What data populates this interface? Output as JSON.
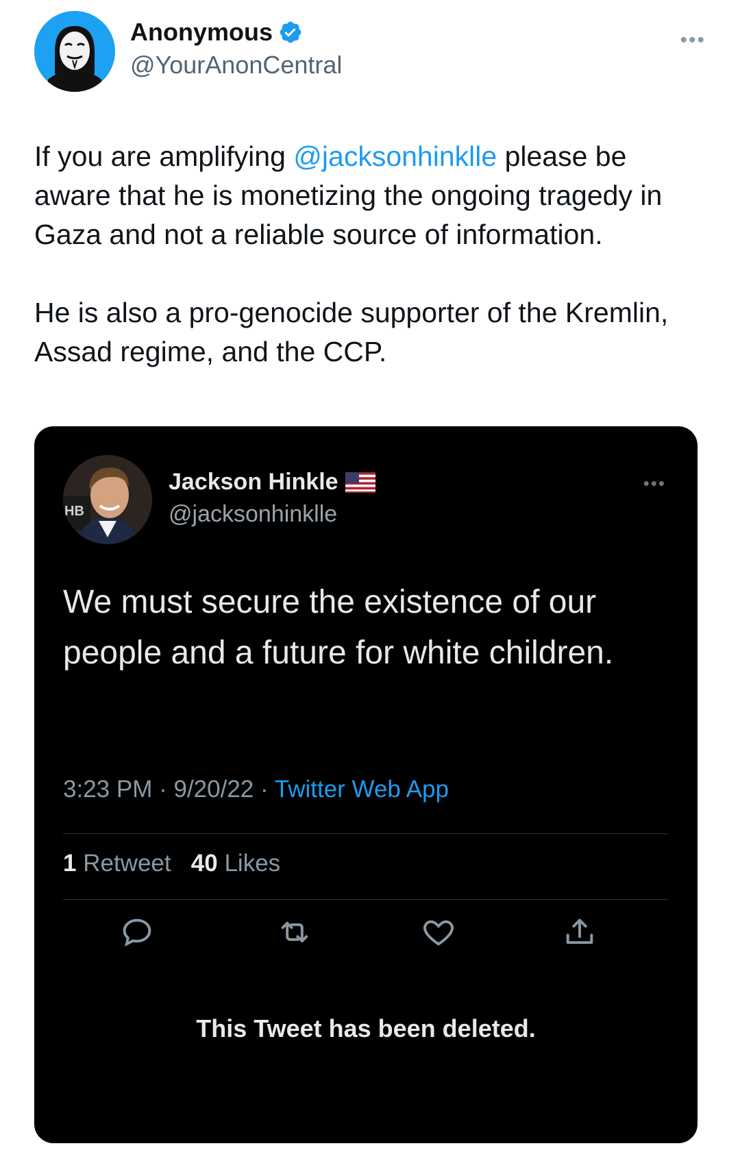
{
  "tweet": {
    "author": {
      "display_name": "Anonymous",
      "handle": "@YourAnonCentral",
      "verified": true,
      "avatar_icon": "anonymous-mask-icon"
    },
    "text": {
      "p1_before": "If you are amplifying ",
      "p1_mention": "@jacksonhinklle",
      "p1_after": " please be aware that he is monetizing the ongoing tragedy in Gaza and not a reliable source of information.",
      "p2": "He is also a pro-genocide supporter of the Kremlin, Assad regime, and the CCP."
    }
  },
  "embedded_tweet": {
    "author": {
      "display_name": "Jackson Hinkle",
      "handle": "@jacksonhinklle",
      "flag_icon": "us-flag-icon"
    },
    "text": "We must secure the existence of our people and a future for white children.",
    "time": "3:23 PM",
    "date": "9/20/22",
    "source": "Twitter Web App",
    "separator": "·",
    "retweets": {
      "count": "1",
      "label": "Retweet"
    },
    "likes": {
      "count": "40",
      "label": "Likes"
    },
    "deleted_notice": "This Tweet has been deleted."
  },
  "colors": {
    "mention": "#1d9bf0",
    "verified_badge": "#1d9bf0",
    "embed_background": "#000000"
  }
}
